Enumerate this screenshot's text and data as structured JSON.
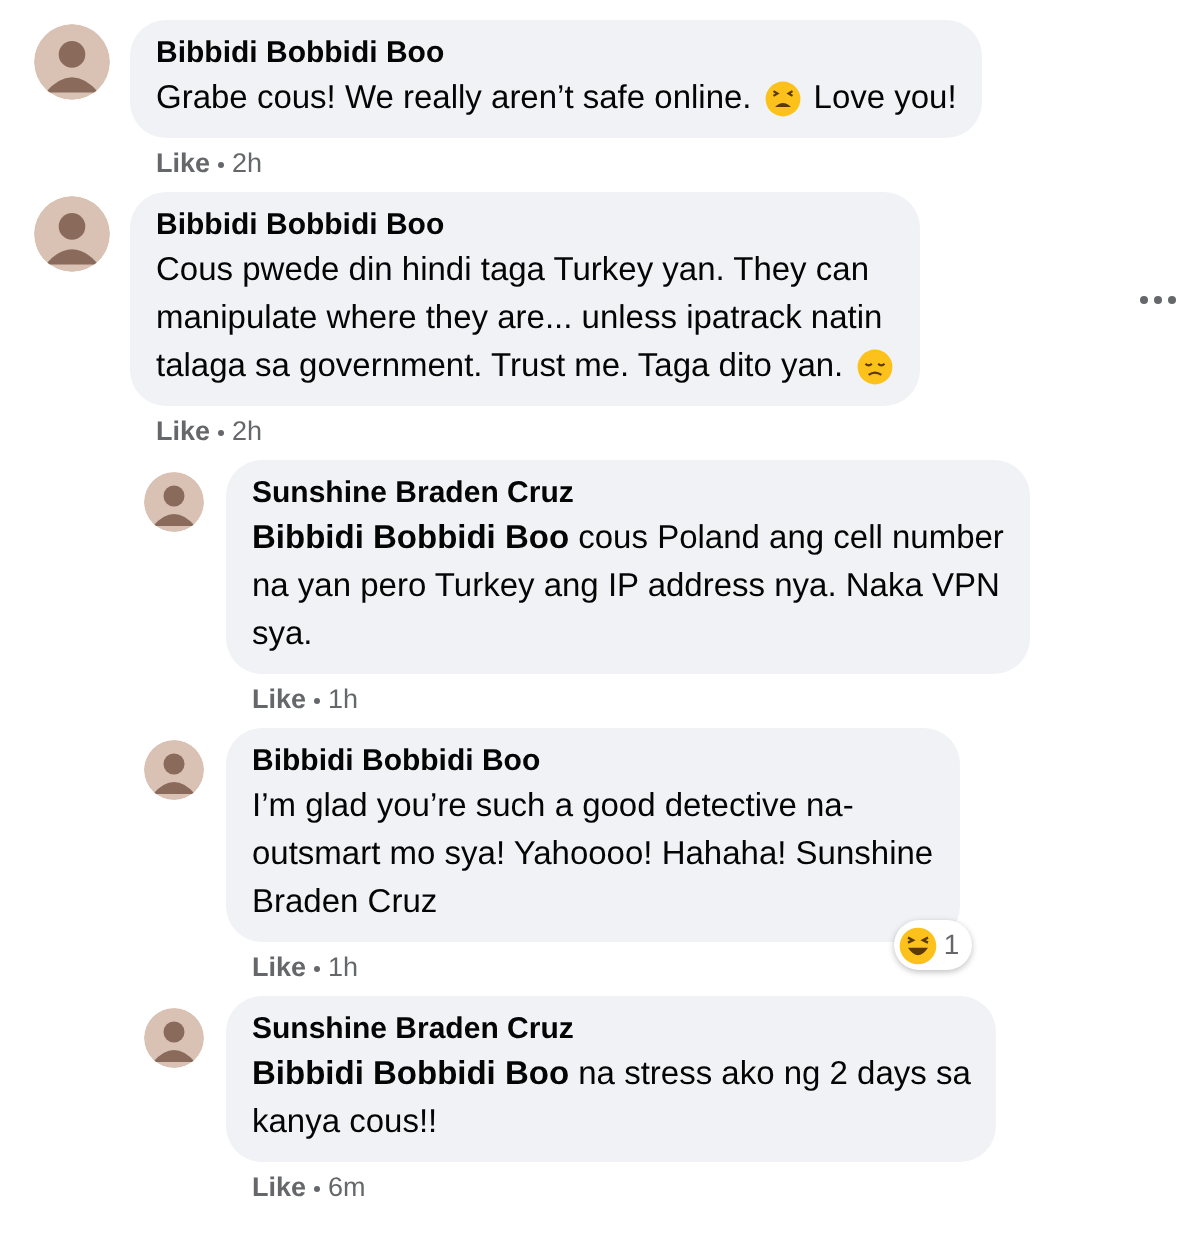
{
  "comments": [
    {
      "author": "Bibbidi Bobbidi Boo",
      "reply": false,
      "lines": [
        [
          {
            "kind": "text",
            "text": "Grabe cous! We really aren’t safe online."
          },
          {
            "kind": "tired"
          },
          {
            "kind": "text",
            "text": "Love you!"
          }
        ]
      ],
      "like": "Like",
      "time": "2h",
      "more": false
    },
    {
      "author": "Bibbidi Bobbidi Boo",
      "reply": false,
      "lines": [
        [
          {
            "kind": "text",
            "text": "Cous pwede din hindi taga Turkey yan. They can"
          }
        ],
        [
          {
            "kind": "text",
            "text": "manipulate where they are... unless ipatrack natin"
          }
        ],
        [
          {
            "kind": "text",
            "text": "talaga sa government. Trust me. Taga dito yan."
          },
          {
            "kind": "disappointed"
          }
        ]
      ],
      "like": "Like",
      "time": "2h",
      "more": true
    },
    {
      "author": "Sunshine Braden Cruz",
      "reply": true,
      "lines": [
        [
          {
            "kind": "text",
            "text": "**Bibbidi Bobbidi Boo** cous Poland ang cell number"
          }
        ],
        [
          {
            "kind": "text",
            "text": "na yan pero Turkey ang IP address nya. Naka VPN"
          }
        ],
        [
          {
            "kind": "text",
            "text": "sya."
          }
        ]
      ],
      "like": "Like",
      "time": "1h",
      "more": false
    },
    {
      "author": "Bibbidi Bobbidi Boo",
      "reply": true,
      "lines": [
        [
          {
            "kind": "text",
            "text": "I’m glad you’re such a good detective na-"
          }
        ],
        [
          {
            "kind": "text",
            "text": "outsmart mo sya! Yahoooo! Hahaha! Sunshine"
          }
        ],
        [
          {
            "kind": "text",
            "text": "Braden Cruz"
          }
        ]
      ],
      "like": "Like",
      "time": "1h",
      "more": false,
      "reaction": {
        "kind": "laughing",
        "count": "1"
      }
    },
    {
      "author": "Sunshine Braden Cruz",
      "reply": true,
      "lines": [
        [
          {
            "kind": "text",
            "text": "**Bibbidi Bobbidi Boo** na stress ako ng 2 days sa"
          }
        ],
        [
          {
            "kind": "text",
            "text": "kanya cous!!"
          }
        ]
      ],
      "like": "Like",
      "time": "6m",
      "more": false
    }
  ]
}
